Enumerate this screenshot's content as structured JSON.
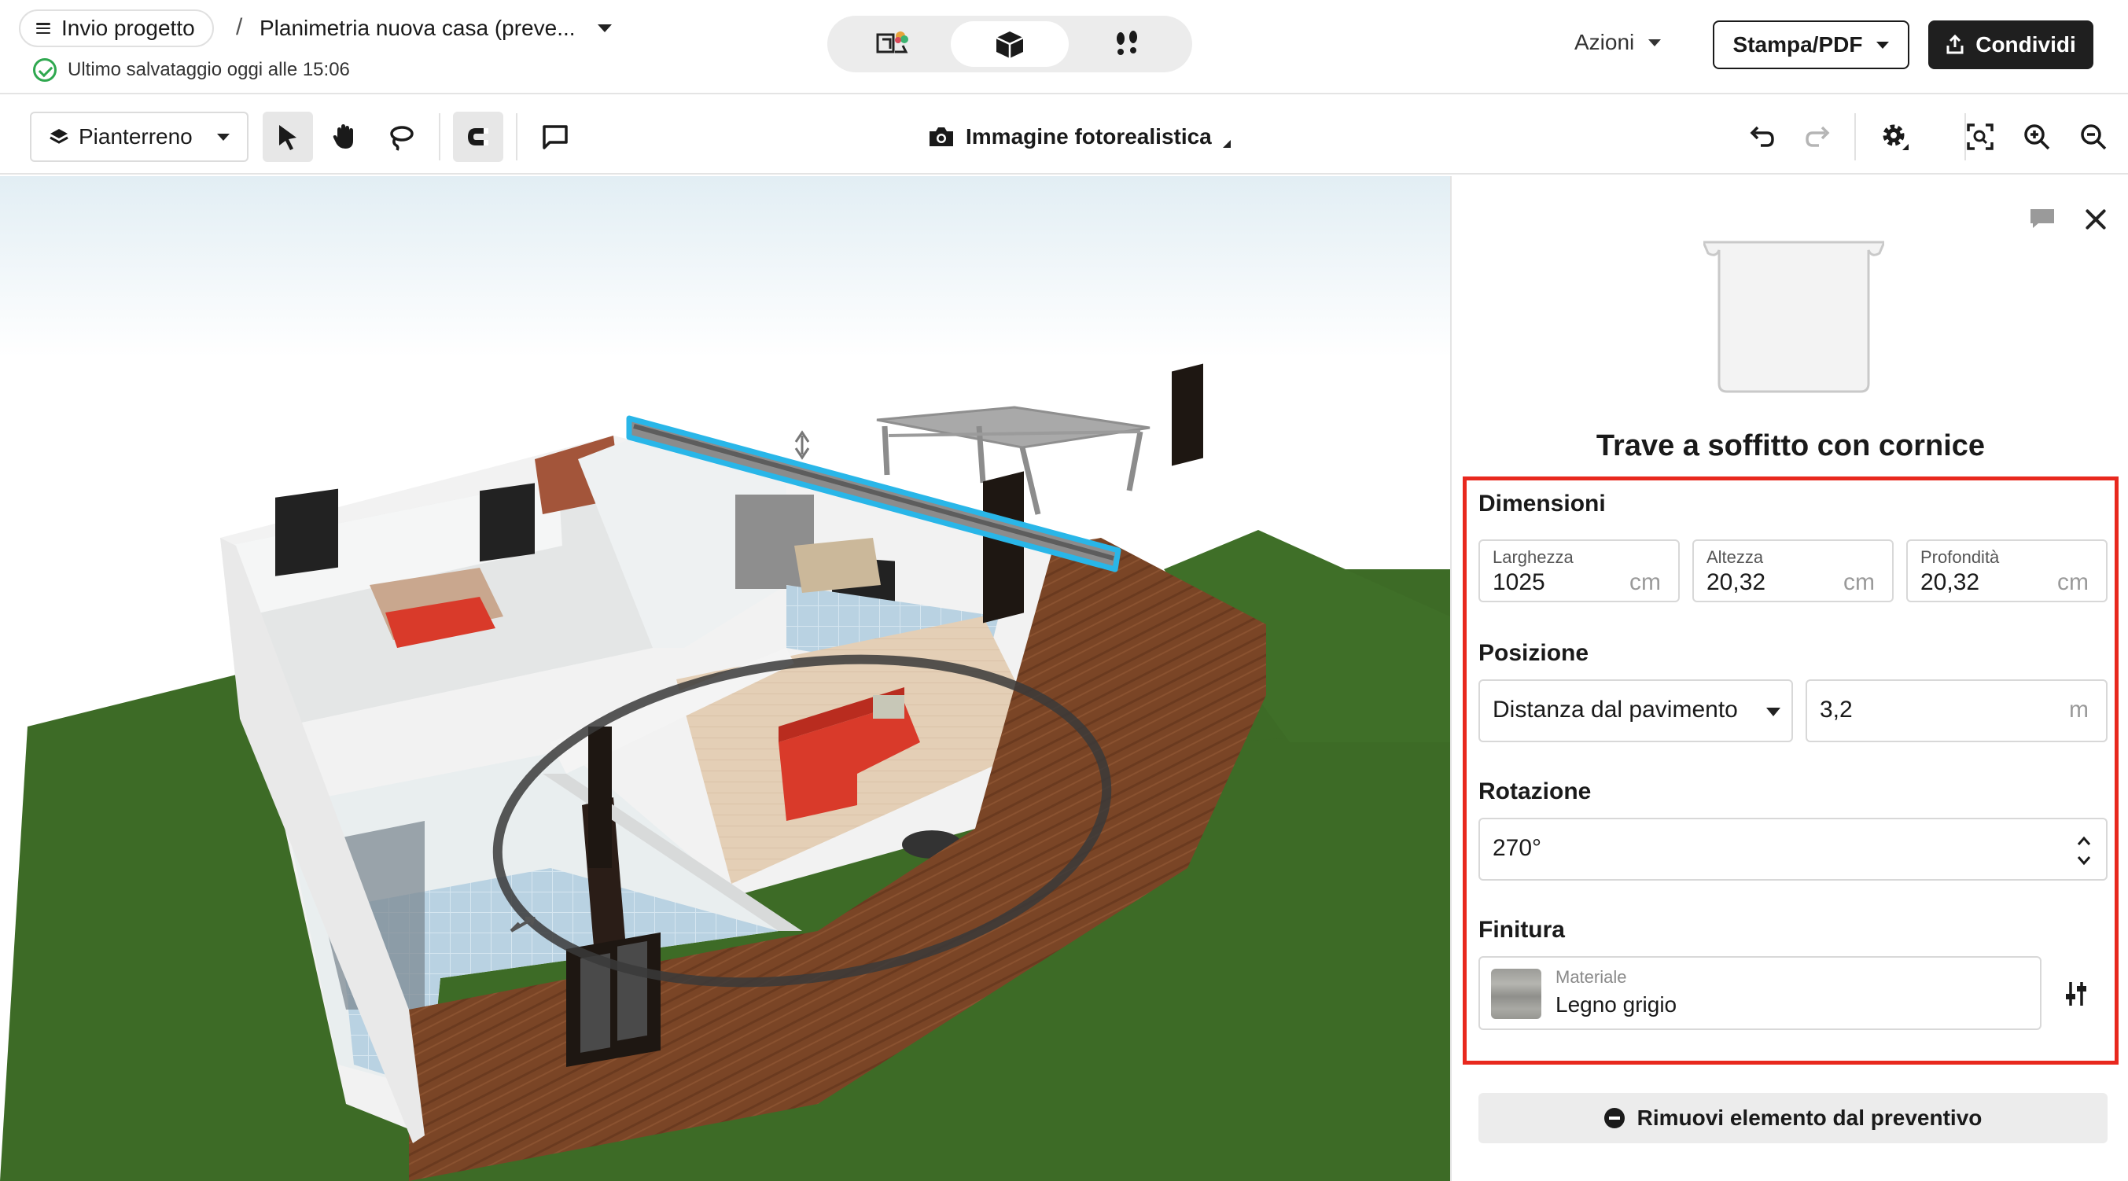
{
  "header": {
    "menu_label": "Invio progetto",
    "separator": "/",
    "project_title": "Planimetria nuova casa (preve...",
    "save_status": "Ultimo salvataggio oggi alle 15:06",
    "actions_label": "Azioni",
    "print_label": "Stampa/PDF",
    "share_label": "Condividi",
    "views": [
      "2d-3d-view-icon",
      "3d-box-view-icon",
      "walkthrough-footprints-icon"
    ],
    "active_view": 1
  },
  "toolbar": {
    "floor_label": "Pianterreno",
    "photo_label": "Immagine fotorealistica",
    "tools": [
      "select-arrow-icon",
      "pan-hand-icon",
      "lasso-icon",
      "magnet-snap-icon",
      "comment-icon"
    ],
    "right_tools": [
      "undo-icon",
      "redo-icon",
      "settings-gear-icon",
      "fit-view-icon",
      "zoom-in-icon",
      "zoom-out-icon"
    ]
  },
  "panel": {
    "item_title": "Trave a soffitto con cornice",
    "dimensions": {
      "title": "Dimensioni",
      "width_label": "Larghezza",
      "width_value": "1025",
      "width_unit": "cm",
      "height_label": "Altezza",
      "height_value": "20,32",
      "height_unit": "cm",
      "depth_label": "Profondità",
      "depth_value": "20,32",
      "depth_unit": "cm"
    },
    "position": {
      "title": "Posizione",
      "mode": "Distanza dal pavimento",
      "value": "3,2",
      "unit": "m"
    },
    "rotation": {
      "title": "Rotazione",
      "value": "270°"
    },
    "finish": {
      "title": "Finitura",
      "material_label": "Materiale",
      "material_value": "Legno grigio"
    },
    "remove_label": "Rimuovi elemento dal preventivo"
  },
  "colors": {
    "highlight": "#e8281e",
    "selection": "#29b6e8",
    "grass": "#3d6b26",
    "wall_wood": "#7a4526",
    "sofa": "#d93a2a"
  }
}
